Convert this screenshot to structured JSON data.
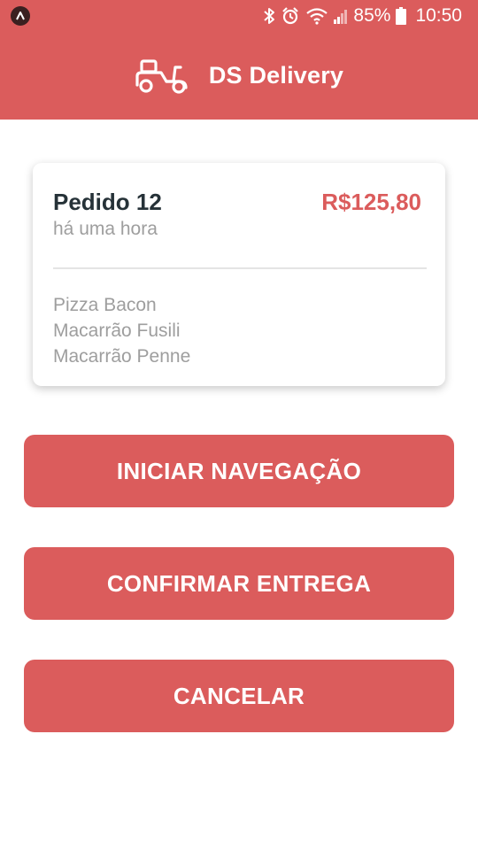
{
  "status_bar": {
    "battery": "85%",
    "time": "10:50",
    "icons": [
      "app-indicator-icon",
      "bluetooth-icon",
      "alarm-icon",
      "wifi-icon",
      "signal-icon",
      "battery-icon"
    ]
  },
  "header": {
    "title": "DS Delivery",
    "logo": "delivery-scooter-icon"
  },
  "order": {
    "title": "Pedido 12",
    "price": "R$125,80",
    "time": "há uma hora",
    "items": [
      "Pizza Bacon",
      "Macarrão Fusili",
      "Macarrão Penne"
    ]
  },
  "actions": {
    "navigate_label": "INICIAR NAVEGAÇÃO",
    "confirm_label": "CONFIRMAR ENTREGA",
    "cancel_label": "CANCELAR"
  },
  "colors": {
    "primary": "#DB5C5C",
    "text_dark": "#263238",
    "text_muted": "#9E9E9E",
    "card_bg": "#FFFFFF"
  }
}
